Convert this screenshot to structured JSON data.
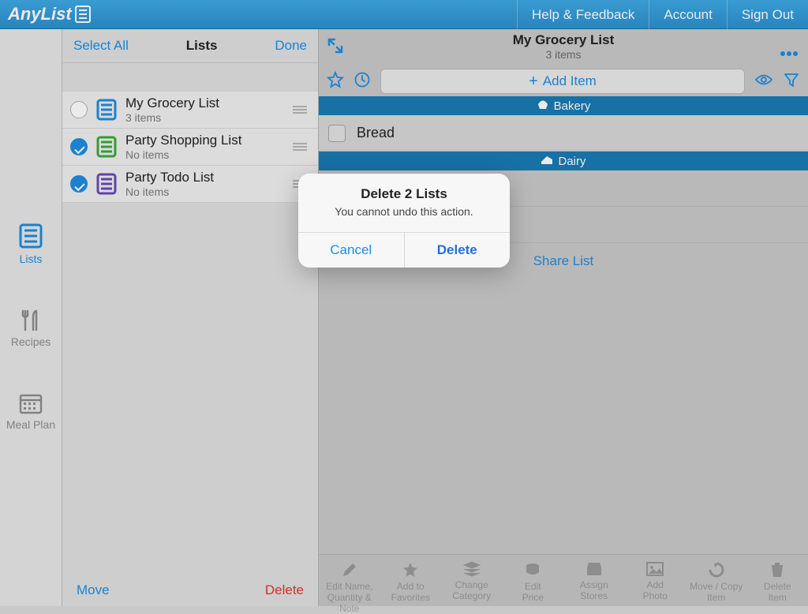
{
  "colors": {
    "accent": "#1f8de0",
    "danger": "#e03434",
    "header": "#1b7bb4"
  },
  "topbar": {
    "brand": "AnyList",
    "links": [
      "Help & Feedback",
      "Account",
      "Sign Out"
    ]
  },
  "rail": {
    "items": [
      {
        "label": "Lists",
        "active": true
      },
      {
        "label": "Recipes"
      },
      {
        "label": "Meal Plan"
      }
    ]
  },
  "midpane": {
    "select_all": "Select All",
    "title": "Lists",
    "done": "Done",
    "footer_move": "Move",
    "footer_delete": "Delete",
    "lists": [
      {
        "title": "My Grocery List",
        "sub": "3 items",
        "selected": false,
        "color": "#1f8de0"
      },
      {
        "title": "Party Shopping List",
        "sub": "No items",
        "selected": true,
        "color": "#3aa93a"
      },
      {
        "title": "Party Todo List",
        "sub": "No items",
        "selected": true,
        "color": "#6a4ab5"
      }
    ]
  },
  "rightpane": {
    "title": "My Grocery List",
    "subtitle": "3 items",
    "add_placeholder": "Add Item",
    "categories": [
      {
        "name": "Bakery",
        "icon": "cupcake-icon",
        "items": [
          {
            "name": "Bread"
          }
        ]
      },
      {
        "name": "Dairy",
        "icon": "cheese-icon",
        "items": []
      }
    ],
    "share_label": "Share List",
    "bottom_actions": [
      {
        "line1": "Edit Name,",
        "line2": "Quantity & Note"
      },
      {
        "line1": "Add to",
        "line2": "Favorites"
      },
      {
        "line1": "Change",
        "line2": "Category"
      },
      {
        "line1": "Edit",
        "line2": "Price"
      },
      {
        "line1": "Assign",
        "line2": "Stores"
      },
      {
        "line1": "Add",
        "line2": "Photo"
      },
      {
        "line1": "Move / Copy",
        "line2": "Item"
      },
      {
        "line1": "Delete",
        "line2": "Item"
      }
    ]
  },
  "modal": {
    "title": "Delete 2 Lists",
    "subtitle": "You cannot undo this action.",
    "cancel": "Cancel",
    "delete": "Delete"
  }
}
